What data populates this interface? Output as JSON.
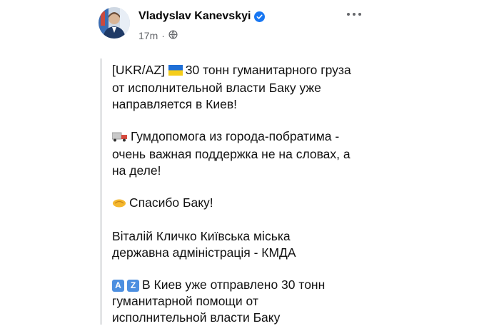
{
  "post": {
    "author": "Vladyslav Kanevskyi",
    "time": "17m",
    "icons": {
      "verified": "verified-badge-icon",
      "audience": "globe-icon",
      "more": "more-options-icon",
      "flag": "ukraine-flag-icon",
      "truck": "truck-icon",
      "handshake": "handshake-icon"
    },
    "colors": {
      "verified": "#1877f2",
      "meta": "#65676b"
    },
    "body": {
      "p1_tag": "[UKR/AZ]",
      "p1_l1": "30 тонн гуманитарного груза",
      "p1_l2": "от исполнительной власти Баку уже",
      "p1_l3": "направляется в Киев!",
      "p2_l1": "Гумдопомога из города-побратима -",
      "p2_l2": "очень важная поддержка не на словах, а",
      "p2_l3": "на деле!",
      "p3_l1": "Спасибо Баку!",
      "p4_l1": "Віталій Кличко Київська міська",
      "p4_l2": "державна адміністрація - КМДА",
      "p5_a": "A",
      "p5_z": "Z",
      "p5_l1": "В Киев уже отправлено 30 тонн",
      "p5_l2": "гуманитарной помощи от",
      "p5_l3": "исполнительной власти Баку"
    }
  }
}
